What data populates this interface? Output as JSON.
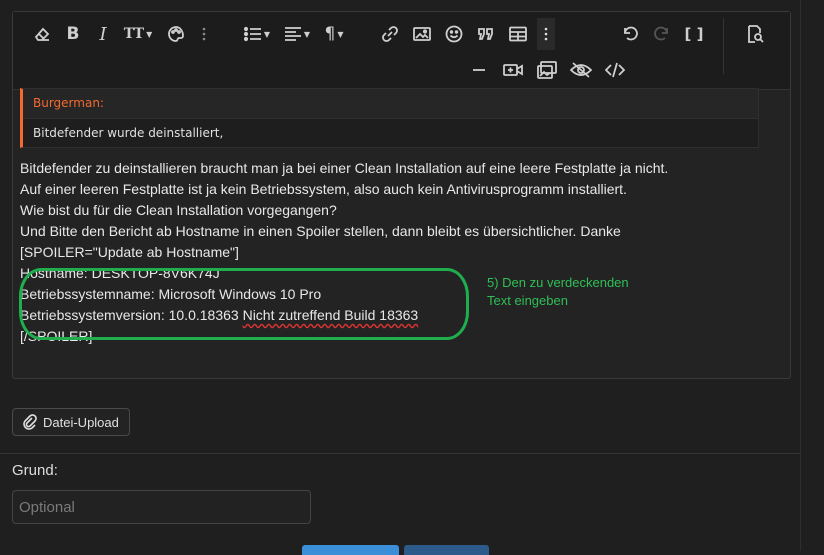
{
  "toolbar": {
    "row1": [
      "eraser-icon",
      "bold-icon",
      "italic-icon",
      "font-size-icon",
      "palette-icon",
      "more-vertical-icon",
      "list-icon",
      "align-icon",
      "paragraph-icon",
      "link-icon",
      "image-icon",
      "smiley-icon",
      "quote-icon",
      "table-icon",
      "more-vertical-icon",
      "undo-icon",
      "redo-icon",
      "brackets-icon",
      "preview-icon"
    ],
    "row2": [
      "horizontal-rule-icon",
      "media-icon",
      "gallery-icon",
      "spoiler-icon",
      "code-icon"
    ],
    "bold": "B",
    "italic": "I",
    "font_size": "TT",
    "paragraph": "¶",
    "brackets": "[ ]"
  },
  "quote": {
    "author": "Burgerman:",
    "text": "Bitdefender wurde deinstalliert,"
  },
  "content_lines": [
    "Bitdefender zu deinstallieren braucht man ja bei einer Clean Installation auf eine leere Festplatte ja nicht.",
    "Auf einer leeren Festplatte ist ja kein Betriebssystem, also auch kein Antivirusprogramm installiert.",
    "Wie bist du für die Clean Installation vorgegangen?",
    "Und Bitte den Bericht ab Hostname in einen Spoiler stellen, dann bleibt es übersichtlicher. Danke",
    "[SPOILER=\"Update ab Hostname\"]",
    "Hostname: DESKTOP-8V6K74J",
    "Betriebssystemname: Microsoft Windows 10 Pro",
    "Betriebssystemversion: 10.0.18363 Nicht zutreffend Build 18363",
    "[/SPOILER]"
  ],
  "annotation": {
    "line1": "5) Den zu verdeckenden",
    "line2": "Text eingeben",
    "color": "#1fad4e"
  },
  "upload_label": "Datei-Upload",
  "reason": {
    "label": "Grund:",
    "placeholder": "Optional"
  },
  "colors": {
    "quote_accent": "#f26a2e",
    "annotation": "#1fad4e",
    "primary_button": "#3a8fd8"
  }
}
